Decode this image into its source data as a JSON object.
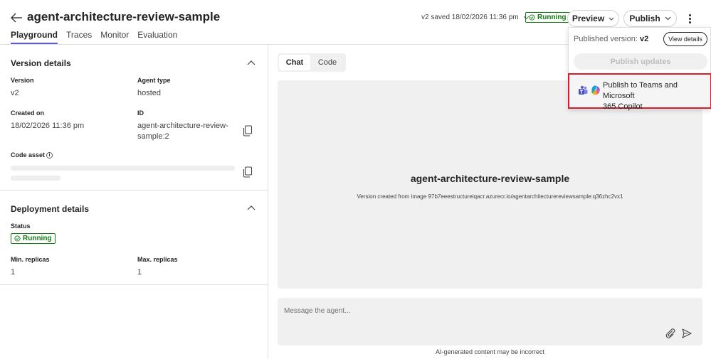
{
  "header": {
    "title": "agent-architecture-review-sample",
    "saved_text": "v2 saved 18/02/2026 11:36 pm",
    "status": "Running",
    "preview_label": "Preview",
    "publish_label": "Publish",
    "tabs": [
      {
        "label": "Playground",
        "active": true
      },
      {
        "label": "Traces",
        "active": false
      },
      {
        "label": "Monitor",
        "active": false
      },
      {
        "label": "Evaluation",
        "active": false
      }
    ]
  },
  "version_details": {
    "title": "Version details",
    "version_label": "Version",
    "version_value": "v2",
    "agent_type_label": "Agent type",
    "agent_type_value": "hosted",
    "created_label": "Created on",
    "created_value": "18/02/2026 11:36 pm",
    "id_label": "ID",
    "id_line1": "agent-architecture-review-",
    "id_line2": "sample:2",
    "code_asset_label": "Code asset"
  },
  "deployment_details": {
    "title": "Deployment details",
    "status_label": "Status",
    "status_value": "Running",
    "min_label": "Min. replicas",
    "min_value": "1",
    "max_label": "Max. replicas",
    "max_value": "1"
  },
  "chat": {
    "tabs": [
      "Chat",
      "Code"
    ],
    "agent_name": "agent-architecture-review-sample",
    "version_info": "Version created from image 97b7eeestructureiqacr.azurecr.io/agentarchitecturereviewsample:q36zhc2vx1",
    "placeholder": "Message the agent...",
    "disclaimer": "AI-generated content may be incorrect"
  },
  "publish_menu": {
    "published_version_label": "Published version:",
    "published_version_value": "v2",
    "view_details": "View details",
    "publish_updates": "Publish updates",
    "teams_line1": "Publish to Teams and Microsoft",
    "teams_line2": "365 Copilot"
  },
  "colors": {
    "accent": "#5b5fc7",
    "running": "#107c10",
    "highlight": "#d21f2b"
  }
}
